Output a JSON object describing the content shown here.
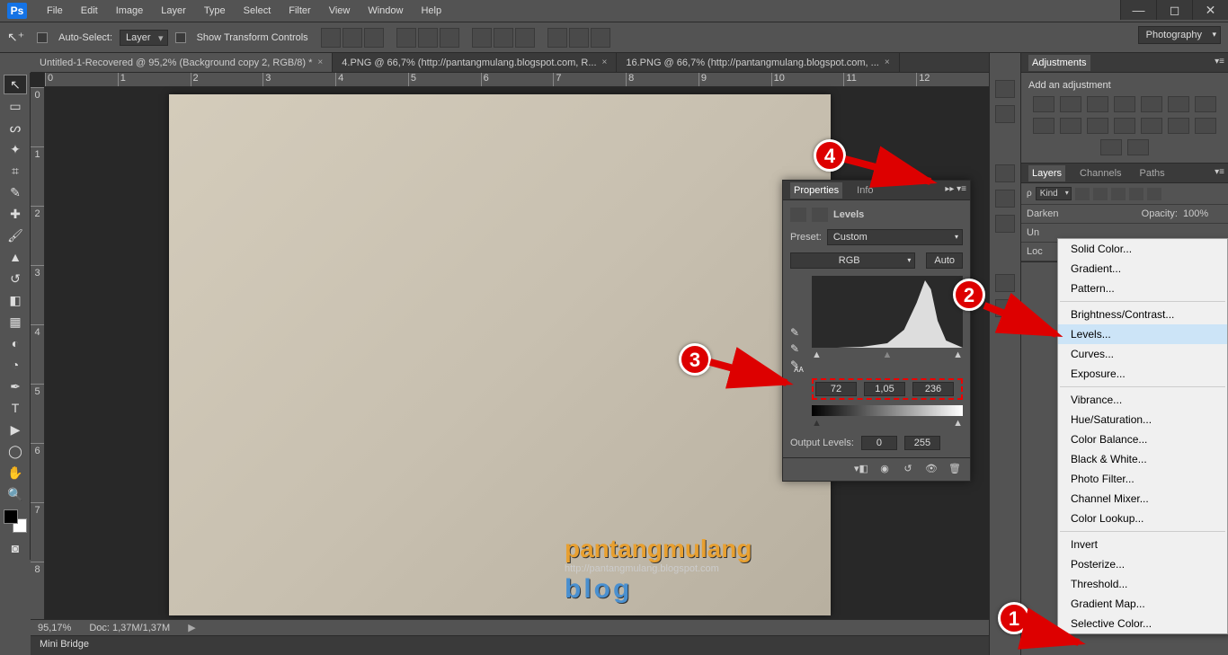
{
  "menubar": {
    "items": [
      "File",
      "Edit",
      "Image",
      "Layer",
      "Type",
      "Select",
      "Filter",
      "View",
      "Window",
      "Help"
    ]
  },
  "options": {
    "auto_select": "Auto-Select:",
    "layer_dd": "Layer",
    "show_transform": "Show Transform Controls"
  },
  "workspace": "Photography",
  "tabs": [
    {
      "label": "Untitled-1-Recovered @ 95,2% (Background copy 2, RGB/8) *",
      "active": true
    },
    {
      "label": "4.PNG @ 66,7% (http://pantangmulang.blogspot.com, R...",
      "active": false
    },
    {
      "label": "16.PNG @ 66,7% (http://pantangmulang.blogspot.com, ...",
      "active": false
    }
  ],
  "ruler_h": [
    "0",
    "1",
    "2",
    "3",
    "4",
    "5",
    "6",
    "7",
    "8",
    "9",
    "10",
    "11",
    "12"
  ],
  "ruler_v": [
    "0",
    "1",
    "2",
    "3",
    "4",
    "5",
    "6",
    "7",
    "8"
  ],
  "status": {
    "zoom": "95,17%",
    "doc": "Doc: 1,37M/1,37M"
  },
  "mini_bridge": "Mini Bridge",
  "panels": {
    "adjustments": {
      "tab": "Adjustments",
      "title": "Add an adjustment"
    },
    "layers": {
      "tabs": [
        "Layers",
        "Channels",
        "Paths"
      ],
      "kind": "Kind",
      "blend": "Darken",
      "opacity_lbl": "Opacity:",
      "opacity_val": "100%",
      "unify": "Un",
      "lock": "Loc"
    }
  },
  "properties": {
    "tabs": [
      "Properties",
      "Info"
    ],
    "title": "Levels",
    "preset_lbl": "Preset:",
    "preset_val": "Custom",
    "channel": "RGB",
    "auto": "Auto",
    "inputs": {
      "black": "72",
      "gamma": "1,05",
      "white": "236"
    },
    "output_lbl": "Output Levels:",
    "out_black": "0",
    "out_white": "255"
  },
  "context_menu": {
    "items": [
      "Solid Color...",
      "Gradient...",
      "Pattern...",
      "-",
      "Brightness/Contrast...",
      "Levels...",
      "Curves...",
      "Exposure...",
      "-",
      "Vibrance...",
      "Hue/Saturation...",
      "Color Balance...",
      "Black & White...",
      "Photo Filter...",
      "Channel Mixer...",
      "Color Lookup...",
      "-",
      "Invert",
      "Posterize...",
      "Threshold...",
      "Gradient Map...",
      "Selective Color..."
    ],
    "highlight": "Levels..."
  },
  "watermark": {
    "brand": "pantangmulang",
    "url": "http://pantangmulang.blogspot.com",
    "blog": "blog"
  },
  "markers": [
    "1",
    "2",
    "3",
    "4"
  ]
}
